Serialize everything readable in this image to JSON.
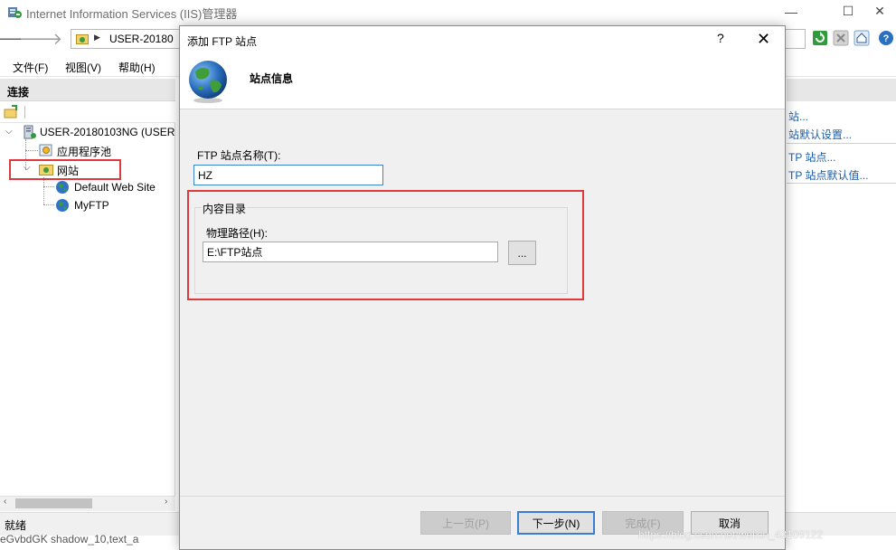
{
  "window": {
    "title": "Internet Information Services (IIS)管理器",
    "minimize_glyph": "—",
    "maximize_glyph": "☐",
    "close_glyph": "✕"
  },
  "address_bar": {
    "path": "USER-20180"
  },
  "menu": {
    "file": "文件(F)",
    "view": "视图(V)",
    "help": "帮助(H)"
  },
  "connections": {
    "title": "连接",
    "tree": {
      "server": "USER-20180103NG (USER",
      "app_pools": "应用程序池",
      "sites": "网站",
      "default_site": "Default Web Site",
      "myftp": "MyFTP"
    }
  },
  "actions": {
    "links": [
      "站...",
      "站默认设置...",
      "TP 站点...",
      "TP 站点默认值..."
    ]
  },
  "status": {
    "text": "就绪",
    "fragment": "eGvbdGK shadow_10,text_a"
  },
  "dialog": {
    "title": "添加 FTP 站点",
    "help": "?",
    "close": "✕",
    "heading": "站点信息",
    "site_name_label": "FTP 站点名称(T):",
    "site_name_value": "HZ",
    "content_group": "内容目录",
    "path_label": "物理路径(H):",
    "path_value": "E:\\FTP站点",
    "browse_label": "...",
    "buttons": {
      "prev": "上一页(P)",
      "next": "下一步(N)",
      "finish": "完成(F)",
      "cancel": "取消"
    }
  },
  "watermark": "https://blog.csdn.net/weixin_43109122",
  "colors": {
    "highlight_box": "#e0393b",
    "link": "#1c5ea8",
    "focus_border": "#3d87c8"
  },
  "icons": [
    "iis-app-icon",
    "back-arrow-icon",
    "forward-arrow-icon",
    "folder-icon",
    "refresh-icon",
    "stop-icon",
    "home-icon",
    "help-icon",
    "server-icon",
    "app-pool-icon",
    "sites-folder-icon",
    "globe-icon"
  ]
}
